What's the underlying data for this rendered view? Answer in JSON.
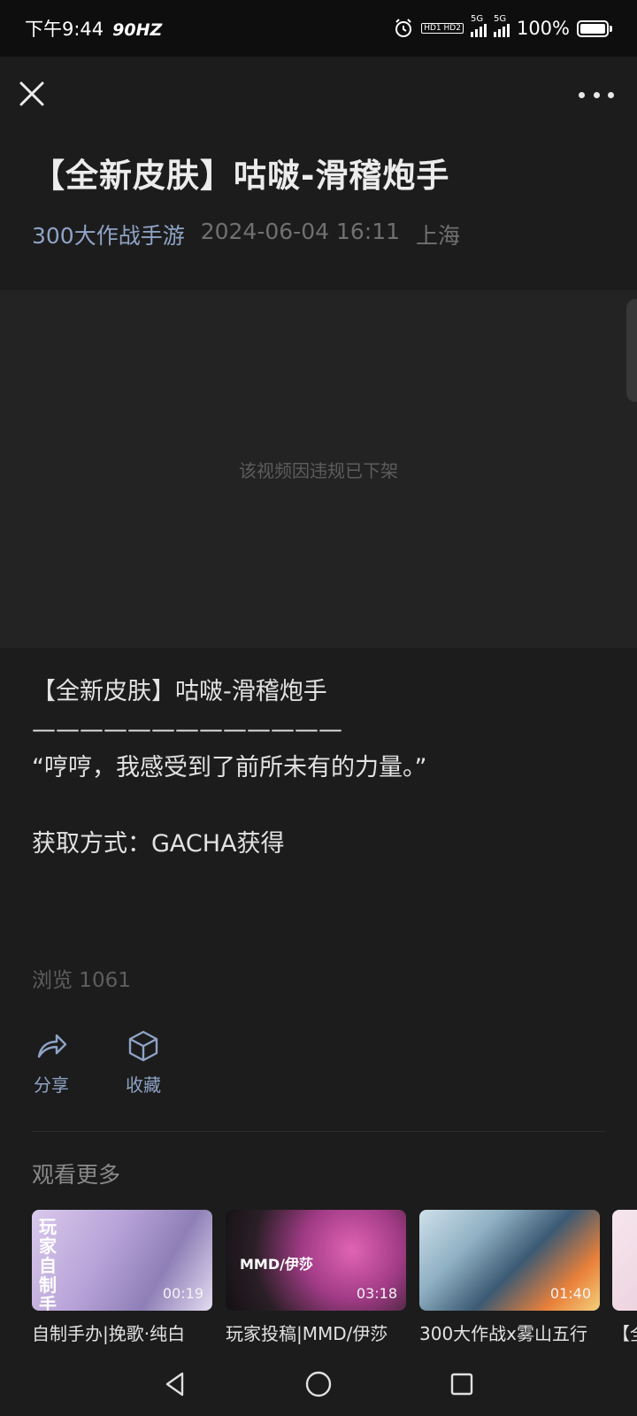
{
  "status_bar": {
    "time": "下午9:44",
    "refresh_rate": "90HZ",
    "hd_label": "HD1 HD2",
    "signal1": "5G",
    "signal2": "5G",
    "battery": "100%"
  },
  "header": {
    "close_icon": "close-icon",
    "more_icon": "more-icon"
  },
  "post": {
    "title": "【全新皮肤】咕啵-滑稽炮手",
    "author": "300大作战手游",
    "date": "2024-06-04 16:11",
    "location": "上海"
  },
  "video": {
    "message": "该视频因违规已下架"
  },
  "description": {
    "lines": [
      "【全新皮肤】咕啵-滑稽炮手",
      "—————————————",
      "“哼哼，我感受到了前所未有的力量。”",
      "",
      "获取方式：GACHA获得"
    ]
  },
  "views": "浏览 1061",
  "actions": {
    "share_label": "分享",
    "share_icon": "share-icon",
    "favorite_label": "收藏",
    "favorite_icon": "box-icon"
  },
  "more_section": {
    "heading": "观看更多",
    "cards": [
      {
        "title": "自制手办|挽歌·纯白",
        "duration": "00:19",
        "thumb_text": "玩家自制手办"
      },
      {
        "title": "玩家投稿|MMD/伊莎",
        "duration": "03:18",
        "thumb_text": "MMD/伊莎"
      },
      {
        "title": "300大作战x雾山五行",
        "duration": "01:40"
      },
      {
        "title": "【全"
      }
    ]
  },
  "nav_bar": {
    "back_icon": "back-triangle-icon",
    "home_icon": "home-circle-icon",
    "recents_icon": "recents-square-icon"
  }
}
